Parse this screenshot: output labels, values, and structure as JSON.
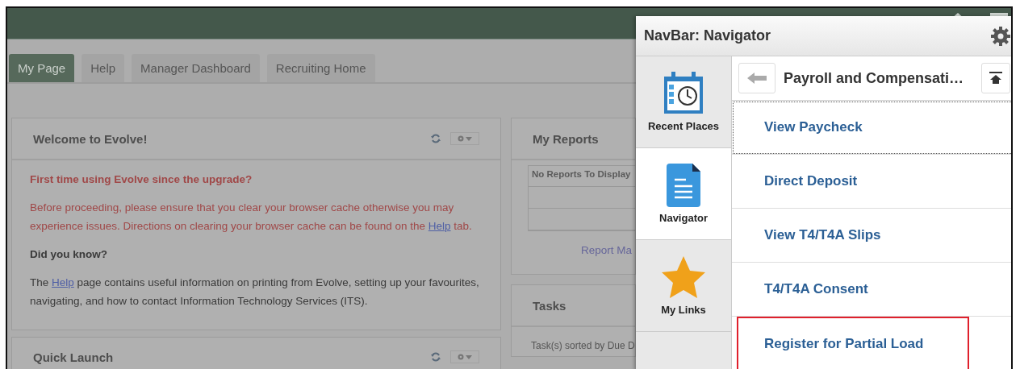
{
  "tabs": [
    {
      "label": "My Page",
      "selected": true
    },
    {
      "label": "Help",
      "selected": false
    },
    {
      "label": "Manager Dashboard",
      "selected": false
    },
    {
      "label": "Recruiting Home",
      "selected": false
    }
  ],
  "welcome": {
    "title": "Welcome to Evolve!",
    "notice_heading": "First time using Evolve since the upgrade?",
    "notice": {
      "before": "Before proceeding, please ensure that you clear your browser cache otherwise you may experience issues. Directions on clearing your browser cache can be found on the ",
      "link": "Help",
      "after": " tab."
    },
    "tip_heading": "Did you know?",
    "tip": {
      "before": "The ",
      "link": "Help",
      "after": " page contains useful information on printing from Evolve, setting up your favourites, navigating, and how to contact Information Technology Services (ITS)."
    }
  },
  "quick_launch": {
    "title": "Quick Launch"
  },
  "my_reports": {
    "title": "My Reports",
    "table_header": "No Reports To Display",
    "link": "Report Ma"
  },
  "tasks": {
    "title": "Tasks",
    "note": "Task(s) sorted by Due D"
  },
  "navbar": {
    "title": "NavBar: Navigator",
    "sections": [
      {
        "kind": "recent",
        "label": "Recent Places",
        "selected": false
      },
      {
        "kind": "navigator",
        "label": "Navigator",
        "selected": true
      },
      {
        "kind": "links",
        "label": "My Links",
        "selected": false
      }
    ],
    "folder": "Payroll and Compensati…",
    "items": [
      {
        "label": "View Paycheck",
        "focused": true,
        "highlighted": false
      },
      {
        "label": "Direct Deposit",
        "focused": false,
        "highlighted": false
      },
      {
        "label": "View T4/T4A Slips",
        "focused": false,
        "highlighted": false
      },
      {
        "label": "T4/T4A Consent",
        "focused": false,
        "highlighted": false
      },
      {
        "label": "Register for Partial Load",
        "focused": false,
        "highlighted": true
      }
    ]
  }
}
